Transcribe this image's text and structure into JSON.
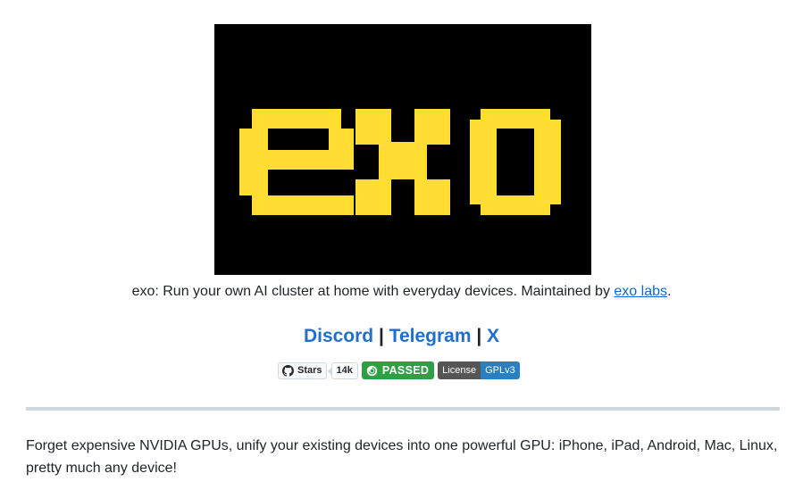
{
  "logo": {
    "text": "exo",
    "bg_color": "#000000",
    "fg_color": "#FFDD33"
  },
  "tagline": {
    "prefix": "exo: Run your own AI cluster at home with everyday devices. Maintained by ",
    "link": "exo labs",
    "suffix": "."
  },
  "links": {
    "discord": "Discord",
    "sep1": " | ",
    "telegram": "Telegram",
    "sep2": " | ",
    "x": "X"
  },
  "badges": {
    "stars_label": "Stars",
    "stars_count": "14k",
    "ci_status": "PASSED",
    "license_label": "License",
    "license_value": "GPLv3"
  },
  "intro": "Forget expensive NVIDIA GPUs, unify your existing devices into one powerful GPU: iPhone, iPad, Android, Mac, Linux, pretty much any device!"
}
